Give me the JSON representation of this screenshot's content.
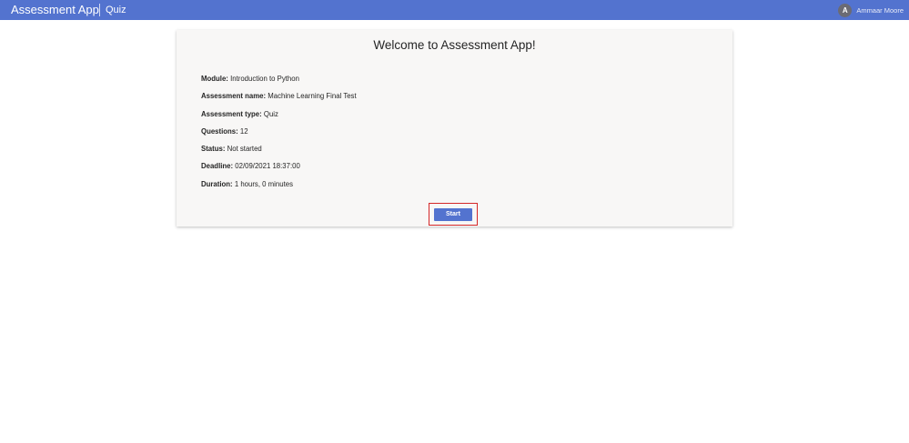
{
  "header": {
    "app_title": "Assessment App",
    "section": "Quiz",
    "user": {
      "initial": "A",
      "name": "Ammaar Moore"
    }
  },
  "card": {
    "title": "Welcome to Assessment App!",
    "fields": [
      {
        "label": "Module:",
        "value": "Introduction to Python"
      },
      {
        "label": "Assessment name:",
        "value": "Machine Learning Final Test"
      },
      {
        "label": "Assessment type:",
        "value": "Quiz"
      },
      {
        "label": "Questions:",
        "value": "12"
      },
      {
        "label": "Status:",
        "value": "Not started"
      },
      {
        "label": "Deadline:",
        "value": "02/09/2021 18:37:00"
      },
      {
        "label": "Duration:",
        "value": "1 hours, 0 minutes"
      }
    ],
    "start_label": "Start"
  },
  "colors": {
    "header_bg": "#5373cf",
    "button_bg": "#5373cf",
    "highlight_border": "#d42828",
    "card_bg": "#f8f7f6",
    "avatar_bg": "#6b6b74"
  }
}
